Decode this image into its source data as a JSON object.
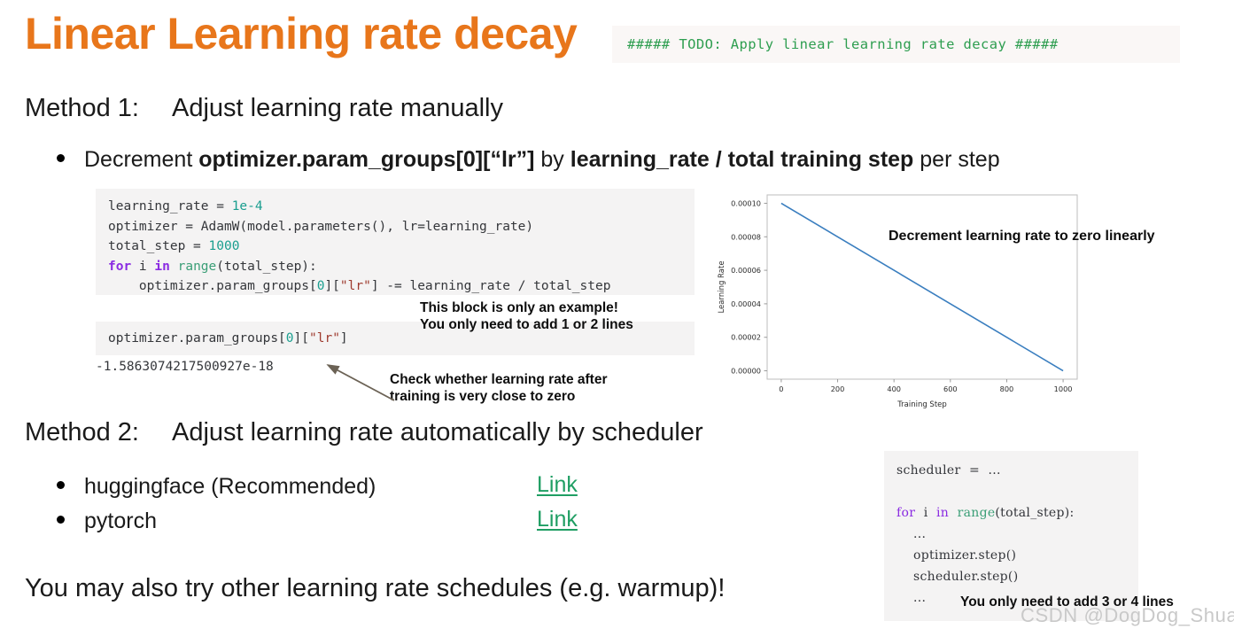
{
  "slide": {
    "title": "Linear Learning rate decay",
    "title_color": "#E8761B",
    "bottom_note": "You may also try other learning rate schedules (e.g. warmup)!",
    "watermark": "CSDN @DogDog_Shuai"
  },
  "todo_strip": {
    "code": "##### TODO: Apply linear learning rate decay #####",
    "color": "#2E9E50"
  },
  "method1": {
    "label": "Method 1:",
    "text": "Adjust learning rate manually",
    "bullet": {
      "prefix": "Decrement ",
      "bold1": "optimizer.param_groups[0][“lr”]",
      "mid": " by ",
      "bold2": "learning_rate / total training step",
      "suffix": " per step"
    }
  },
  "method2": {
    "label": "Method 2:",
    "text": "Adjust learning rate automatically by scheduler",
    "bullets": [
      {
        "label": "huggingface (Recommended)",
        "link": "Link"
      },
      {
        "label": "pytorch",
        "link": "Link"
      }
    ],
    "link_color": "#1F9E63"
  },
  "code_main": {
    "lines": [
      [
        {
          "t": "learning_rate = ",
          "c": "plain"
        },
        {
          "t": "1e-4",
          "c": "num"
        }
      ],
      [
        {
          "t": "optimizer = AdamW(model.parameters(), lr=learning_rate)",
          "c": "plain"
        }
      ],
      [
        {
          "t": "total_step = ",
          "c": "plain"
        },
        {
          "t": "1000",
          "c": "num"
        }
      ],
      [
        {
          "t": "for",
          "c": "kw"
        },
        {
          "t": " i ",
          "c": "plain"
        },
        {
          "t": "in",
          "c": "kw"
        },
        {
          "t": " ",
          "c": "plain"
        },
        {
          "t": "range",
          "c": "fn"
        },
        {
          "t": "(total_step):",
          "c": "plain"
        }
      ],
      [
        {
          "t": "    optimizer.param_groups[",
          "c": "plain"
        },
        {
          "t": "0",
          "c": "num"
        },
        {
          "t": "][",
          "c": "plain"
        },
        {
          "t": "\"lr\"",
          "c": "str"
        },
        {
          "t": "] -= learning_rate / total_step",
          "c": "plain"
        }
      ]
    ]
  },
  "code_inspect": {
    "lines": [
      [
        {
          "t": "optimizer.param_groups[",
          "c": "plain"
        },
        {
          "t": "0",
          "c": "num"
        },
        {
          "t": "][",
          "c": "plain"
        },
        {
          "t": "\"lr\"",
          "c": "str"
        },
        {
          "t": "]",
          "c": "plain"
        }
      ]
    ]
  },
  "code_output": {
    "value": "-1.5863074217500927e-18"
  },
  "annotations": {
    "example_note": "This block is only an example!\nYou only need to add 1 or 2 lines",
    "check_note": "Check whether learning rate after\ntraining is very close to zero",
    "chart_note": "Decrement learning rate to zero linearly",
    "sched_note": "You only need to add 3 or 4 lines"
  },
  "code_scheduler": {
    "lines": [
      [
        {
          "t": "scheduler  =  ...",
          "c": "plain"
        }
      ],
      [
        {
          "t": " ",
          "c": "plain"
        }
      ],
      [
        {
          "t": "for",
          "c": "kw"
        },
        {
          "t": "  i  ",
          "c": "plain"
        },
        {
          "t": "in",
          "c": "kw"
        },
        {
          "t": "  ",
          "c": "plain"
        },
        {
          "t": "range",
          "c": "fn"
        },
        {
          "t": "(total_step):",
          "c": "plain"
        }
      ],
      [
        {
          "t": "    ...",
          "c": "plain"
        }
      ],
      [
        {
          "t": "    optimizer.step()",
          "c": "plain"
        }
      ],
      [
        {
          "t": "    scheduler.step()",
          "c": "plain"
        }
      ],
      [
        {
          "t": "    ...",
          "c": "plain"
        }
      ]
    ]
  },
  "chart_data": {
    "type": "line",
    "title": "",
    "xlabel": "Training Step",
    "ylabel": "Learning Rate",
    "xlim": [
      -50,
      1050
    ],
    "ylim": [
      -5e-06,
      0.000105
    ],
    "xticks": [
      0,
      200,
      400,
      600,
      800,
      1000
    ],
    "xticklabels": [
      "0",
      "200",
      "400",
      "600",
      "800",
      "1000"
    ],
    "yticks": [
      0.0,
      2e-05,
      4e-05,
      6e-05,
      8e-05,
      0.0001
    ],
    "yticklabels": [
      "0.00000",
      "0.00002",
      "0.00004",
      "0.00006",
      "0.00008",
      "0.00010"
    ],
    "grid": false,
    "legend": null,
    "line_color": "#3A7EBF",
    "series": [
      {
        "name": "learning rate",
        "x": [
          0,
          200,
          400,
          600,
          800,
          1000
        ],
        "y": [
          0.0001,
          8e-05,
          6e-05,
          4e-05,
          2e-05,
          0.0
        ]
      }
    ]
  }
}
